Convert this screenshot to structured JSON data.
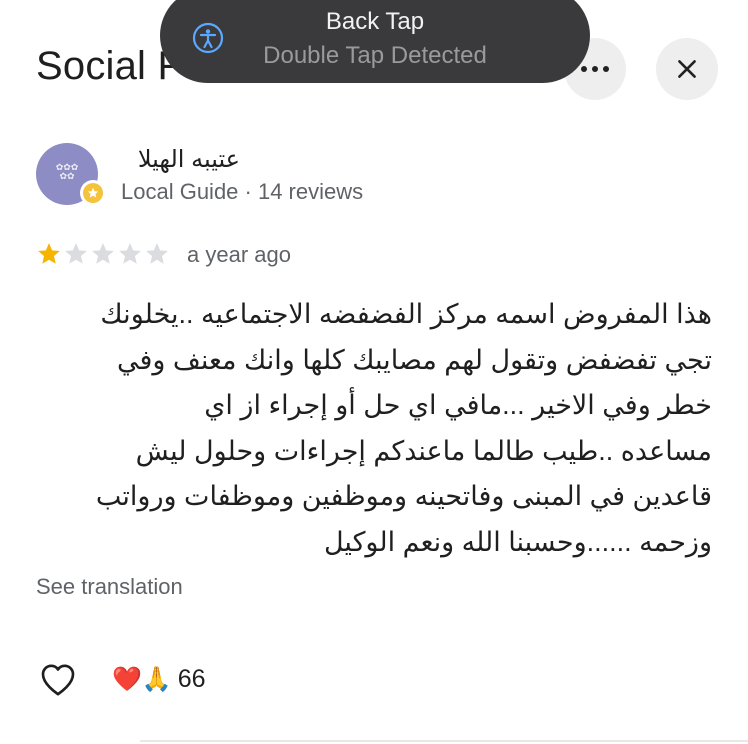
{
  "header": {
    "title": "Social F",
    "more_icon": "more-horizontal-icon",
    "close_icon": "close-icon"
  },
  "toast": {
    "title": "Back Tap",
    "subtitle": "Double Tap Detected",
    "icon": "accessibility-icon",
    "icon_color": "#5aa9ff"
  },
  "review": {
    "author": "عتيبه الهيلا",
    "meta": "Local Guide · 14 reviews",
    "rating": 1,
    "max_rating": 5,
    "time": "a year ago",
    "text": "هذا المفروض اسمه مركز الفضفضه  الاجتماعيه ..يخلونك\nتجي تفضفض وتقول لهم مصايبك كلها وانك معنف وفي\nخطر وفي الاخير ...مافي اي حل أو إجراء از اي\nمساعده ..طيب طالما ماعندكم إجراءات وحلول  ليش\nقاعدين في المبنى وفاتحينه وموظفين وموظفات ورواتب\nوزحمه  ......وحسبنا الله ونعم الوكيل",
    "see_translation": "See translation",
    "reactions": {
      "emojis": "❤️🙏",
      "count": "66"
    }
  },
  "colors": {
    "star_filled": "#f4b400",
    "star_empty": "#dadce0",
    "avatar_bg": "#8d8cc4",
    "badge": "#f5c33b",
    "toast_bg": "#3a3a3c"
  }
}
